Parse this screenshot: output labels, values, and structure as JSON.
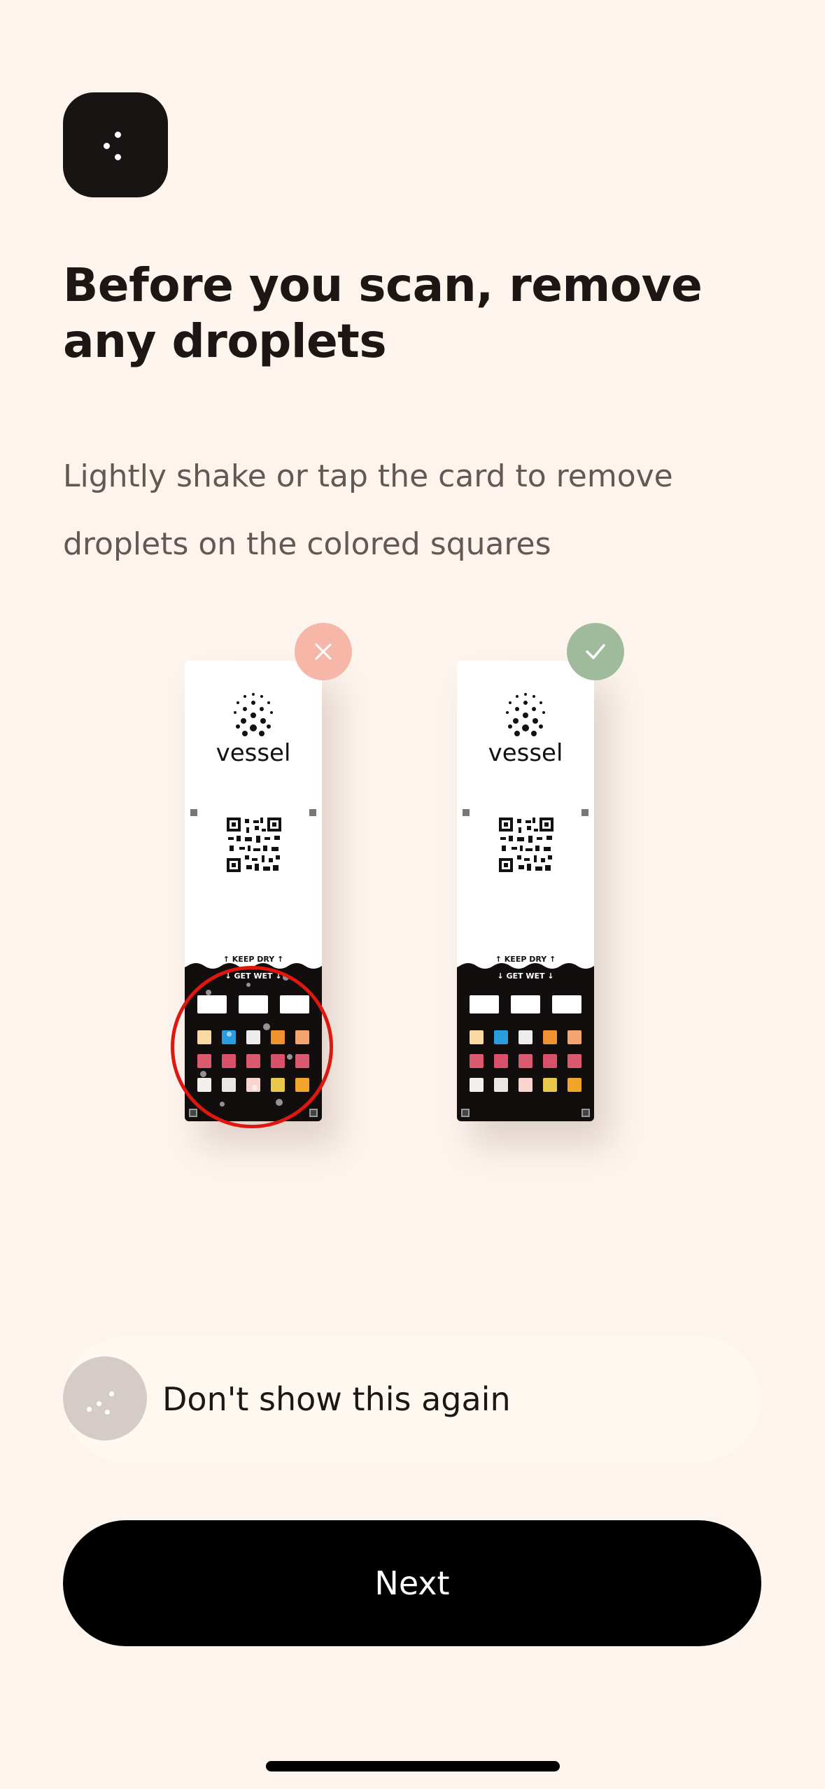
{
  "header": {
    "back_icon": "dots-back-icon"
  },
  "title": "Before you scan, remove any droplets",
  "subtitle": "Lightly shake or tap the card to remove droplets on the colored squares",
  "illustration": {
    "wrong_card": {
      "badge_icon": "x-icon",
      "badge_color": "#f6b6a8",
      "brand": "vessel",
      "keep_dry": "KEEP DRY",
      "get_wet": "GET WET",
      "highlight_color": "#e0170f"
    },
    "right_card": {
      "badge_icon": "check-icon",
      "badge_color": "#9fbb9c",
      "brand": "vessel",
      "keep_dry": "KEEP DRY",
      "get_wet": "GET WET"
    },
    "swatch_colors": [
      [
        "#f9d9a6",
        "#2a9de0",
        "#ececec",
        "#f0922f",
        "#f4a570"
      ],
      [
        "#d95a6f",
        "#d9506a",
        "#d95a6f",
        "#d9506a",
        "#d95a6f"
      ],
      [
        "#f3efec",
        "#ece7e4",
        "#f9d5cf",
        "#e8c94a",
        "#f0a52a"
      ]
    ]
  },
  "dont_show": {
    "label": "Don't show this again",
    "checked": false
  },
  "next_button": {
    "label": "Next"
  },
  "colors": {
    "background": "#fdf4ee",
    "primary_button": "#000000",
    "toggle_inactive": "#d5cbc7"
  }
}
